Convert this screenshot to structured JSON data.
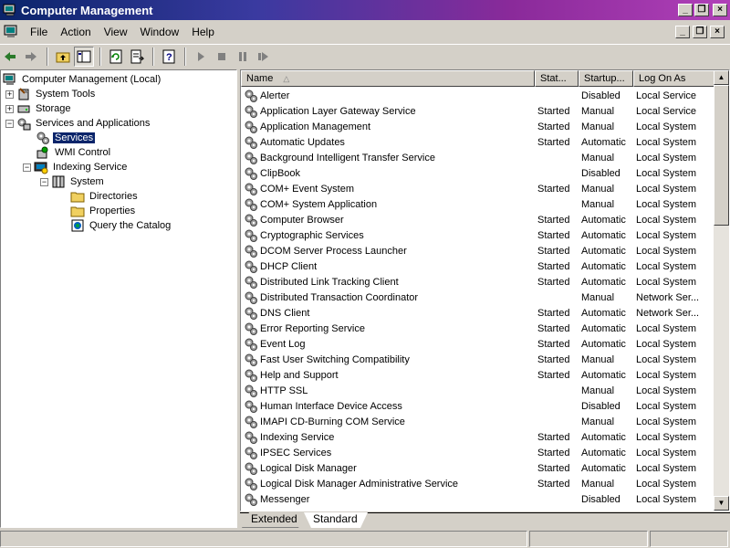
{
  "window": {
    "title": "Computer Management"
  },
  "caption_buttons": {
    "minimize": "_",
    "restore": "❐",
    "close": "×"
  },
  "menubar": {
    "items": [
      {
        "label": "File"
      },
      {
        "label": "Action"
      },
      {
        "label": "View"
      },
      {
        "label": "Window"
      },
      {
        "label": "Help"
      }
    ]
  },
  "toolbar": {
    "buttons": [
      "back-icon",
      "forward-icon",
      "up-folder-icon",
      "show-hide-tree-icon",
      "refresh-icon",
      "export-list-icon",
      "help-icon",
      "start-service-icon",
      "stop-service-icon",
      "pause-service-icon",
      "restart-service-icon"
    ]
  },
  "tree": {
    "items": [
      {
        "label": "Computer Management (Local)",
        "icon": "computer-icon"
      },
      {
        "label": "System Tools",
        "icon": "tools-icon",
        "expander": "+"
      },
      {
        "label": "Storage",
        "icon": "storage-icon",
        "expander": "+"
      },
      {
        "label": "Services and Applications",
        "icon": "services-apps-icon",
        "expander": "−"
      },
      {
        "label": "Services",
        "icon": "services-gear-icon",
        "selected": true
      },
      {
        "label": "WMI Control",
        "icon": "wmi-icon"
      },
      {
        "label": "Indexing Service",
        "icon": "indexing-icon",
        "expander": "−"
      },
      {
        "label": "System",
        "icon": "catalog-icon",
        "expander": "−"
      },
      {
        "label": "Directories",
        "icon": "folder-icon"
      },
      {
        "label": "Properties",
        "icon": "folder-icon"
      },
      {
        "label": "Query the Catalog",
        "icon": "query-icon"
      }
    ]
  },
  "list": {
    "columns": {
      "name": "Name",
      "sort_indicator": "△",
      "status": "Stat...",
      "startup": "Startup...",
      "logon": "Log On As"
    },
    "rows": [
      {
        "name": "Alerter",
        "status": "",
        "startup": "Disabled",
        "logon": "Local Service"
      },
      {
        "name": "Application Layer Gateway Service",
        "status": "Started",
        "startup": "Manual",
        "logon": "Local Service"
      },
      {
        "name": "Application Management",
        "status": "Started",
        "startup": "Manual",
        "logon": "Local System"
      },
      {
        "name": "Automatic Updates",
        "status": "Started",
        "startup": "Automatic",
        "logon": "Local System"
      },
      {
        "name": "Background Intelligent Transfer Service",
        "status": "",
        "startup": "Manual",
        "logon": "Local System"
      },
      {
        "name": "ClipBook",
        "status": "",
        "startup": "Disabled",
        "logon": "Local System"
      },
      {
        "name": "COM+ Event System",
        "status": "Started",
        "startup": "Manual",
        "logon": "Local System"
      },
      {
        "name": "COM+ System Application",
        "status": "",
        "startup": "Manual",
        "logon": "Local System"
      },
      {
        "name": "Computer Browser",
        "status": "Started",
        "startup": "Automatic",
        "logon": "Local System"
      },
      {
        "name": "Cryptographic Services",
        "status": "Started",
        "startup": "Automatic",
        "logon": "Local System"
      },
      {
        "name": "DCOM Server Process Launcher",
        "status": "Started",
        "startup": "Automatic",
        "logon": "Local System"
      },
      {
        "name": "DHCP Client",
        "status": "Started",
        "startup": "Automatic",
        "logon": "Local System"
      },
      {
        "name": "Distributed Link Tracking Client",
        "status": "Started",
        "startup": "Automatic",
        "logon": "Local System"
      },
      {
        "name": "Distributed Transaction Coordinator",
        "status": "",
        "startup": "Manual",
        "logon": "Network Ser..."
      },
      {
        "name": "DNS Client",
        "status": "Started",
        "startup": "Automatic",
        "logon": "Network Ser..."
      },
      {
        "name": "Error Reporting Service",
        "status": "Started",
        "startup": "Automatic",
        "logon": "Local System"
      },
      {
        "name": "Event Log",
        "status": "Started",
        "startup": "Automatic",
        "logon": "Local System"
      },
      {
        "name": "Fast User Switching Compatibility",
        "status": "Started",
        "startup": "Manual",
        "logon": "Local System"
      },
      {
        "name": "Help and Support",
        "status": "Started",
        "startup": "Automatic",
        "logon": "Local System"
      },
      {
        "name": "HTTP SSL",
        "status": "",
        "startup": "Manual",
        "logon": "Local System"
      },
      {
        "name": "Human Interface Device Access",
        "status": "",
        "startup": "Disabled",
        "logon": "Local System"
      },
      {
        "name": "IMAPI CD-Burning COM Service",
        "status": "",
        "startup": "Manual",
        "logon": "Local System"
      },
      {
        "name": "Indexing Service",
        "status": "Started",
        "startup": "Automatic",
        "logon": "Local System"
      },
      {
        "name": "IPSEC Services",
        "status": "Started",
        "startup": "Automatic",
        "logon": "Local System"
      },
      {
        "name": "Logical Disk Manager",
        "status": "Started",
        "startup": "Automatic",
        "logon": "Local System"
      },
      {
        "name": "Logical Disk Manager Administrative Service",
        "status": "Started",
        "startup": "Manual",
        "logon": "Local System"
      },
      {
        "name": "Messenger",
        "status": "",
        "startup": "Disabled",
        "logon": "Local System"
      }
    ]
  },
  "tabs": [
    {
      "label": "Extended"
    },
    {
      "label": "Standard",
      "active": true
    }
  ],
  "colors": {
    "selection": "#0a246a",
    "face": "#d4d0c8",
    "title_start": "#0a246a",
    "title_end": "#b040b8"
  }
}
